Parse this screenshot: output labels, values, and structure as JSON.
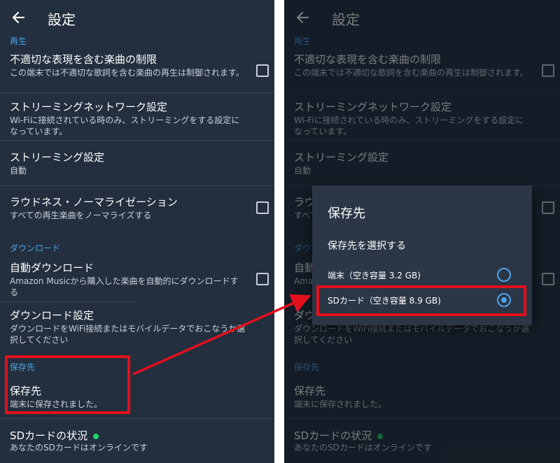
{
  "header": {
    "title": "設定",
    "back_icon": "arrow-left-icon"
  },
  "sections": {
    "playback": "再生",
    "download": "ダウンロード",
    "save": "保存先"
  },
  "items": {
    "explicit": {
      "title": "不適切な表現を含む楽曲の制限",
      "sub": "この端末では不適切な歌詞を含む楽曲の再生は制御されます。"
    },
    "network": {
      "title": "ストリーミングネットワーク設定",
      "sub": "Wi-Fiに接続されている時のみ、ストリーミングをする設定になっています。"
    },
    "streaming": {
      "title": "ストリーミング設定",
      "sub": "自動"
    },
    "loudness": {
      "title": "ラウドネス・ノーマライゼーション",
      "sub": "すべての再生楽曲をノーマライズする"
    },
    "auto_download": {
      "title": "自動ダウンロード",
      "sub": "Amazon Musicから購入した楽曲を自動的にダウンロードする"
    },
    "download_settings": {
      "title": "ダウンロード設定",
      "sub": "ダウンロードをWiFi接続またはモバイルデータでおこなうか選択してください"
    },
    "storage": {
      "title": "保存先",
      "sub": "端末に保存されました。"
    },
    "sd_status": {
      "title": "SDカードの状況",
      "sub": "あなたのSDカードはオンラインです"
    }
  },
  "dialog": {
    "title": "保存先",
    "subtitle": "保存先を選択する",
    "options": [
      {
        "label": "端末（空き容量 3.2 GB)",
        "selected": false
      },
      {
        "label": "SDカード（空き容量 8.9 GB)",
        "selected": true
      }
    ]
  },
  "colors": {
    "panel_bg": "#232f3e",
    "accent": "#4ea3e8",
    "highlight": "#e3101c",
    "status_green": "#1fd36a"
  }
}
